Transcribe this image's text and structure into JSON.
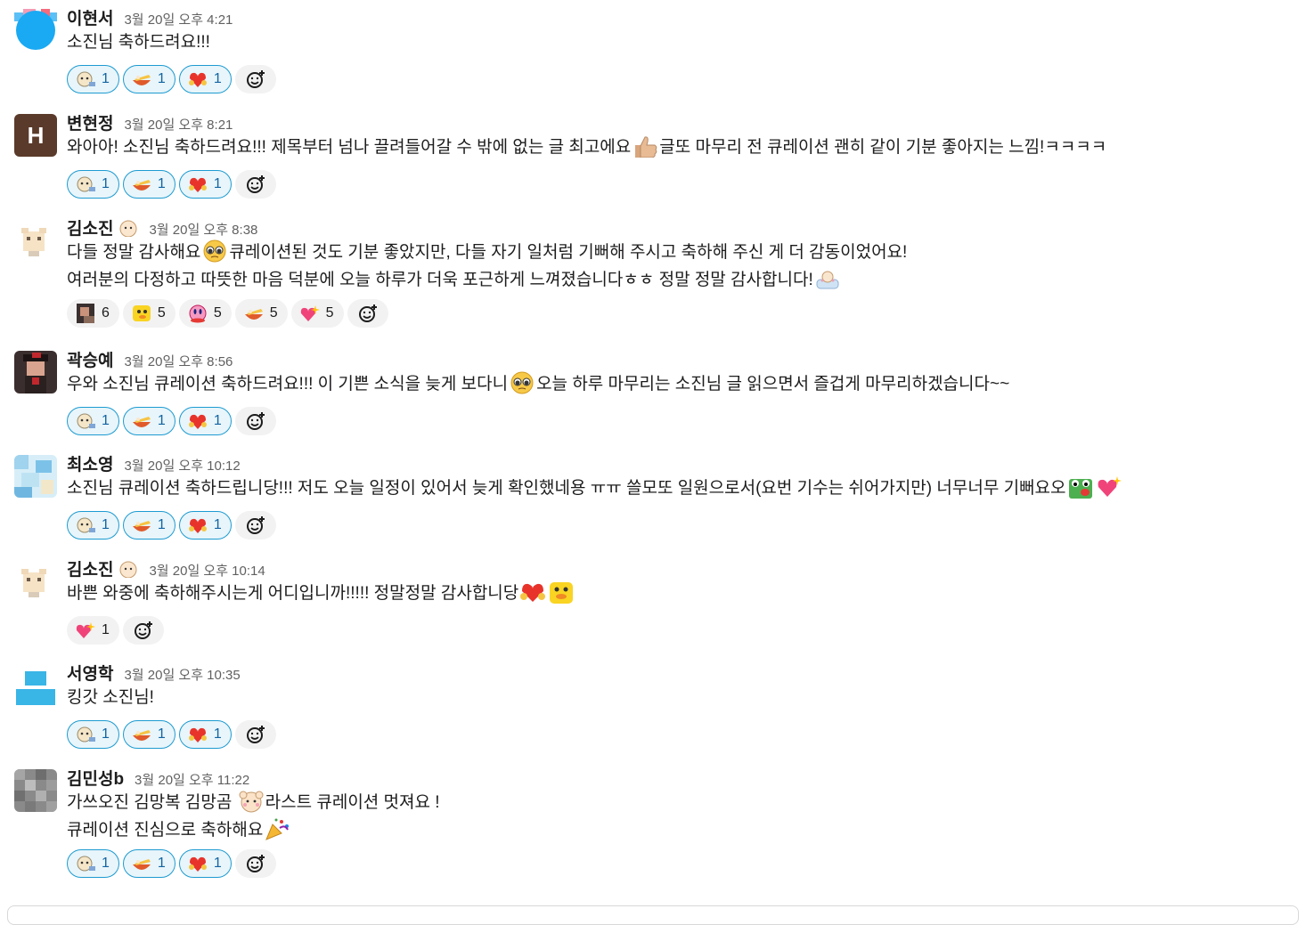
{
  "messages": [
    {
      "author": "이현서",
      "timestamp": "3월 20일 오후 4:21",
      "lines": [
        "소진님 축하드려요!!!"
      ],
      "reactions": [
        {
          "emoji": "baby-angel-emoji",
          "count": "1",
          "mine": true
        },
        {
          "emoji": "noodle-bowl-emoji",
          "count": "1",
          "mine": true
        },
        {
          "emoji": "heart-hands-emoji",
          "count": "1",
          "mine": true
        }
      ]
    },
    {
      "author": "변현정",
      "timestamp": "3월 20일 오후 8:21",
      "avatar_letter": "H",
      "lines": [
        "와아아! 소진님 축하드려요!!! 제목부터 넘나 끌려들어갈 수 밖에 없는 글 최고에요",
        "글또 마무리 전 큐레이션 괜히 같이 기분 좋아지는 느낌!ㅋㅋㅋㅋ"
      ],
      "reactions": [
        {
          "emoji": "baby-angel-emoji",
          "count": "1",
          "mine": true
        },
        {
          "emoji": "noodle-bowl-emoji",
          "count": "1",
          "mine": true
        },
        {
          "emoji": "heart-hands-emoji",
          "count": "1",
          "mine": true
        }
      ]
    },
    {
      "author": "김소진",
      "timestamp": "3월 20일 오후 8:38",
      "lines": [
        "다들 정말 감사해요",
        "큐레이션된 것도 기분 좋았지만, 다들 자기 일처럼 기뻐해 주시고 축하해 주신 게 더 감동이었어요!",
        "여러분의 다정하고 따뜻한 마음 덕분에 오늘 하루가 더욱 포근하게 느껴졌습니다ㅎㅎ 정말 정말 감사합니다!"
      ],
      "reactions": [
        {
          "emoji": "photo-person-emoji",
          "count": "6",
          "mine": false
        },
        {
          "emoji": "yellow-duck-emoji",
          "count": "5",
          "mine": false
        },
        {
          "emoji": "kirby-emoji",
          "count": "5",
          "mine": false
        },
        {
          "emoji": "noodle-bowl-emoji",
          "count": "5",
          "mine": false
        },
        {
          "emoji": "sparkling-heart-emoji",
          "count": "5",
          "mine": false
        }
      ]
    },
    {
      "author": "곽승예",
      "timestamp": "3월 20일 오후 8:56",
      "lines": [
        "우와 소진님 큐레이션 축하드려요!!! 이 기쁜 소식을 늦게 보다니",
        "오늘 하루 마무리는 소진님 글 읽으면서 즐겁게 마무리하겠습니다~~"
      ],
      "reactions": [
        {
          "emoji": "baby-angel-emoji",
          "count": "1",
          "mine": true
        },
        {
          "emoji": "noodle-bowl-emoji",
          "count": "1",
          "mine": true
        },
        {
          "emoji": "heart-hands-emoji",
          "count": "1",
          "mine": true
        }
      ]
    },
    {
      "author": "최소영",
      "timestamp": "3월 20일 오후 10:12",
      "lines": [
        "소진님 큐레이션 축하드립니당!!! 저도 오늘 일정이 있어서 늦게 확인했네용 ㅠㅠ 쓸모또 일원으로서(요번 기수는 쉬어가지만) 너무너무 기뻐요오"
      ],
      "reactions": [
        {
          "emoji": "baby-angel-emoji",
          "count": "1",
          "mine": true
        },
        {
          "emoji": "noodle-bowl-emoji",
          "count": "1",
          "mine": true
        },
        {
          "emoji": "heart-hands-emoji",
          "count": "1",
          "mine": true
        }
      ]
    },
    {
      "author": "김소진",
      "timestamp": "3월 20일 오후 10:14",
      "lines": [
        "바쁜 와중에 축하해주시는게 어디입니까!!!!! 정말정말 감사합니당"
      ],
      "reactions": [
        {
          "emoji": "sparkling-heart-emoji",
          "count": "1",
          "mine": false
        }
      ]
    },
    {
      "author": "서영학",
      "timestamp": "3월 20일 오후 10:35",
      "lines": [
        "킹갓 소진님!"
      ],
      "reactions": [
        {
          "emoji": "baby-angel-emoji",
          "count": "1",
          "mine": true
        },
        {
          "emoji": "noodle-bowl-emoji",
          "count": "1",
          "mine": true
        },
        {
          "emoji": "heart-hands-emoji",
          "count": "1",
          "mine": true
        }
      ]
    },
    {
      "author": "김민성b",
      "timestamp": "3월 20일 오후 11:22",
      "lines": [
        "가쓰오진 김망복 김망곰",
        "라스트 큐레이션 멋져요 !",
        "큐레이션 진심으로 축하해요"
      ],
      "reactions": [
        {
          "emoji": "baby-angel-emoji",
          "count": "1",
          "mine": true
        },
        {
          "emoji": "noodle-bowl-emoji",
          "count": "1",
          "mine": true
        },
        {
          "emoji": "heart-hands-emoji",
          "count": "1",
          "mine": true
        }
      ]
    }
  ],
  "icons": {
    "add_reaction": "add-reaction-icon"
  },
  "colors": {
    "mine_border": "#1d9bd1",
    "mine_bg": "#e8f5fa",
    "mine_text": "#1264a3"
  }
}
